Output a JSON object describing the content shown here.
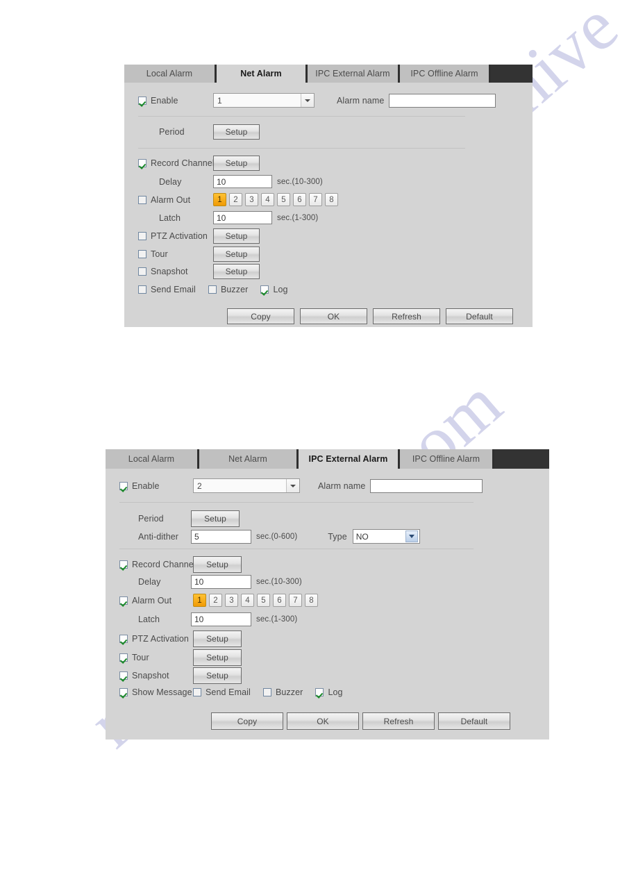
{
  "watermark": {
    "text": "manualshive.com"
  },
  "common": {
    "tabs": [
      "Local Alarm",
      "Net Alarm",
      "IPC External Alarm",
      "IPC Offline Alarm"
    ],
    "labels": {
      "enable": "Enable",
      "alarm_name": "Alarm name",
      "period": "Period",
      "anti_dither": "Anti-dither",
      "type": "Type",
      "record_channel": "Record Channel",
      "delay": "Delay",
      "alarm_out": "Alarm Out",
      "latch": "Latch",
      "ptz_activation": "PTZ Activation",
      "tour": "Tour",
      "snapshot": "Snapshot",
      "show_message": "Show Message",
      "send_email": "Send Email",
      "buzzer": "Buzzer",
      "log": "Log",
      "setup": "Setup"
    },
    "units": {
      "delay": "sec.(10-300)",
      "latch": "sec.(1-300)",
      "anti_dither": "sec.(0-600)"
    },
    "alarm_out_chips": [
      "1",
      "2",
      "3",
      "4",
      "5",
      "6",
      "7",
      "8"
    ],
    "actions": [
      "Copy",
      "OK",
      "Refresh",
      "Default"
    ],
    "colors": {
      "panel_bg": "#d4d4d4",
      "tab_bg": "#c0c0c0",
      "tab_active_bg": "#d4d4d4",
      "tab_strip_dark": "#333333",
      "chip_selected": "#f5a700",
      "check_green": "#1a8a28",
      "watermark": "#b9bbe0"
    }
  },
  "panel_net": {
    "active_tab": "Net Alarm",
    "enable_checked": true,
    "channel_value": "1",
    "alarm_name_value": "",
    "record_channel_checked": true,
    "delay_value": "10",
    "alarm_out_checked": false,
    "alarm_out_selected": "1",
    "latch_value": "10",
    "ptz_checked": false,
    "tour_checked": false,
    "snapshot_checked": false,
    "send_email_checked": false,
    "buzzer_checked": false,
    "log_checked": true
  },
  "panel_ipc": {
    "active_tab": "IPC External Alarm",
    "enable_checked": true,
    "channel_value": "2",
    "alarm_name_value": "",
    "anti_dither_value": "5",
    "type_value": "NO",
    "record_channel_checked": true,
    "delay_value": "10",
    "alarm_out_checked": true,
    "alarm_out_selected": "1",
    "latch_value": "10",
    "ptz_checked": true,
    "tour_checked": true,
    "snapshot_checked": true,
    "show_message_checked": true,
    "send_email_checked": false,
    "buzzer_checked": false,
    "log_checked": true
  }
}
